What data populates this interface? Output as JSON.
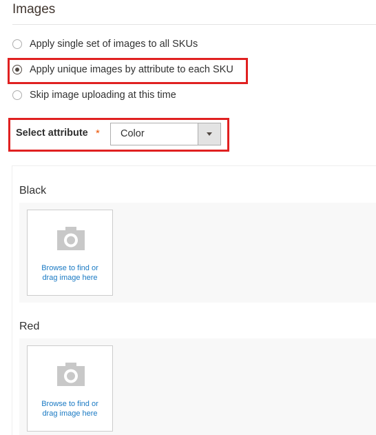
{
  "section": {
    "title": "Images"
  },
  "options": [
    {
      "label": "Apply single set of images to all SKUs",
      "checked": false
    },
    {
      "label": "Apply unique images by attribute to each SKU",
      "checked": true
    },
    {
      "label": "Skip image uploading at this time",
      "checked": false
    }
  ],
  "attribute": {
    "label": "Select attribute",
    "required_mark": "*",
    "value": "Color"
  },
  "groups": [
    {
      "name": "Black",
      "upload_line1": "Browse to find or",
      "upload_line2": "drag image here"
    },
    {
      "name": "Red",
      "upload_line1": "Browse to find or",
      "upload_line2": "drag image here"
    }
  ],
  "colors": {
    "highlight": "#e02020",
    "link": "#1979c3",
    "required": "#eb5202",
    "icon": "#c8c8c8"
  }
}
